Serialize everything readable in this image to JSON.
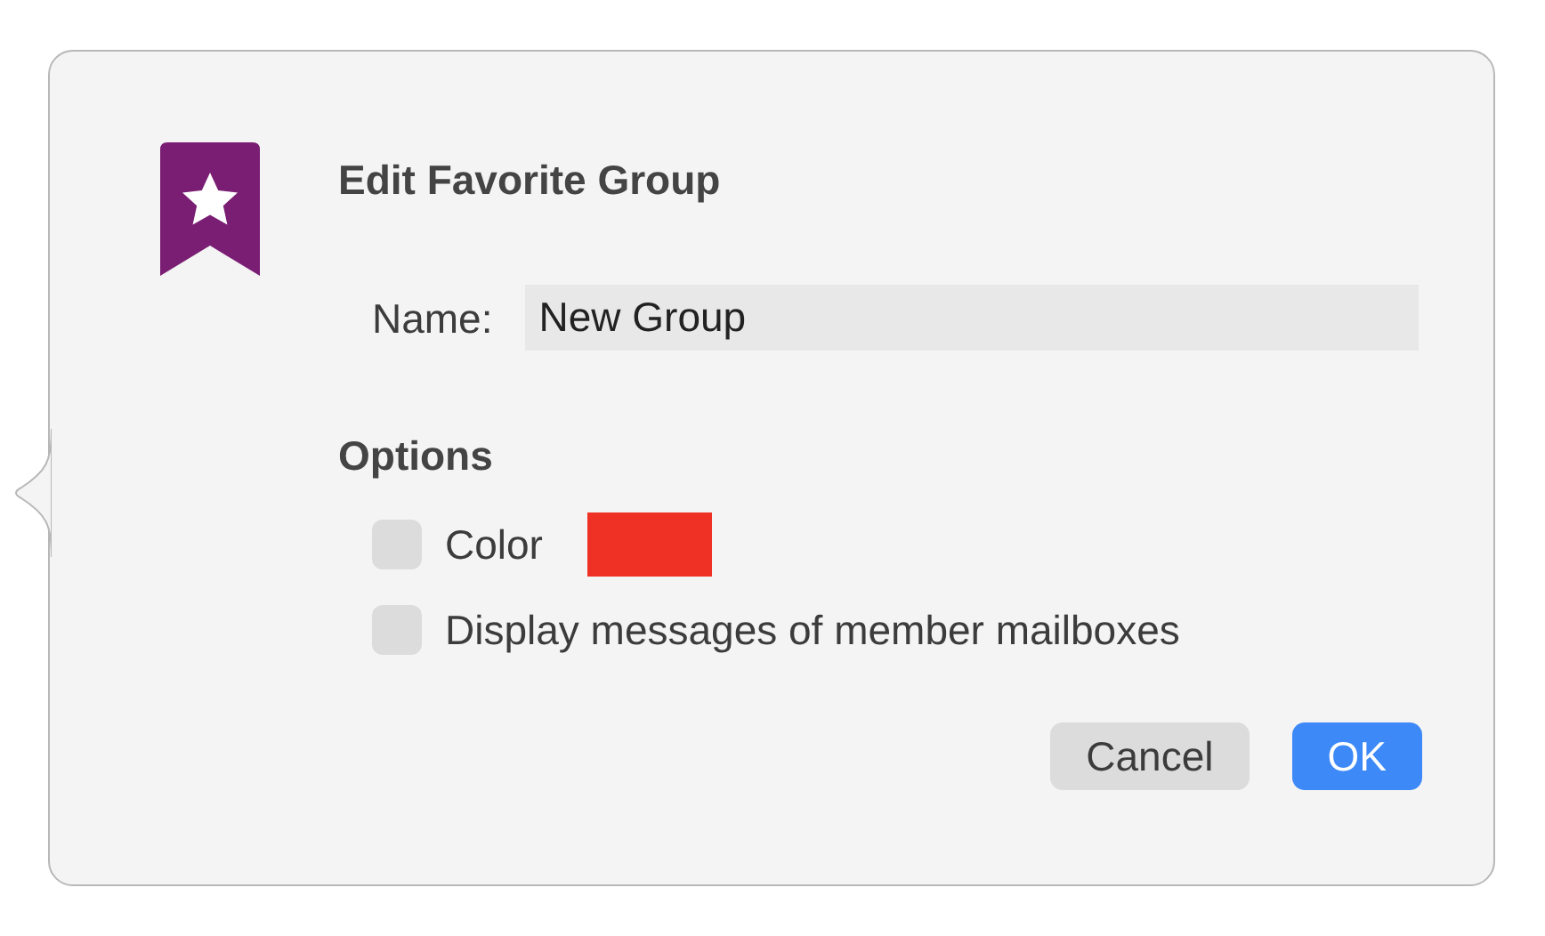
{
  "title": "Edit Favorite Group",
  "name_field": {
    "label": "Name:",
    "value": "New Group"
  },
  "options_heading": "Options",
  "options": [
    {
      "kind": "color",
      "label": "Color",
      "checked": false,
      "color": "#ee3124"
    },
    {
      "kind": "checkbox",
      "label": "Display messages of member mailboxes",
      "checked": false
    }
  ],
  "buttons": [
    {
      "label": "Cancel",
      "kind": "secondary"
    },
    {
      "label": "OK",
      "kind": "primary"
    }
  ]
}
